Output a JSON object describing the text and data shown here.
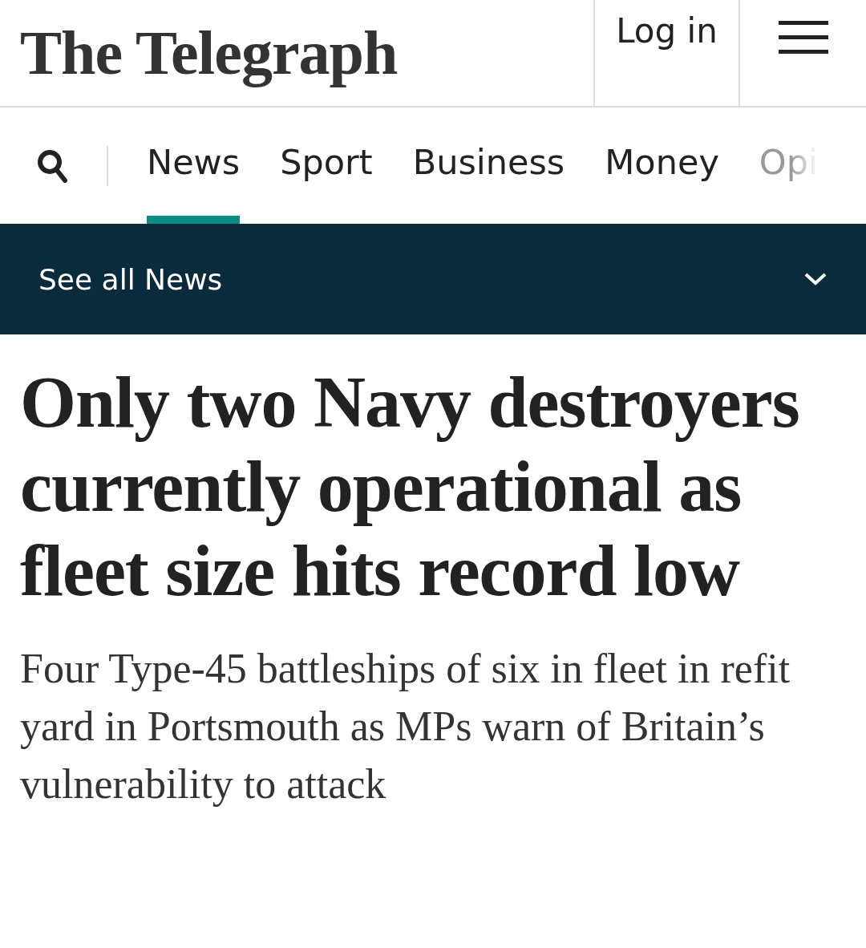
{
  "header": {
    "logo": "The Telegraph",
    "login": "Log in"
  },
  "nav": {
    "items": [
      {
        "label": "News",
        "selected": true
      },
      {
        "label": "Sport",
        "selected": false
      },
      {
        "label": "Business",
        "selected": false
      },
      {
        "label": "Money",
        "selected": false
      },
      {
        "label": "Opi",
        "selected": false
      }
    ]
  },
  "section_bar": {
    "label": "See all News",
    "expanded": false
  },
  "article": {
    "headline": "Only two Navy destroyers currently operational as fleet size hits record low",
    "standfirst": "Four Type-45 battleships of six in fleet in refit yard in Portsmouth as MPs warn of Britain’s vulnerability to attack"
  }
}
